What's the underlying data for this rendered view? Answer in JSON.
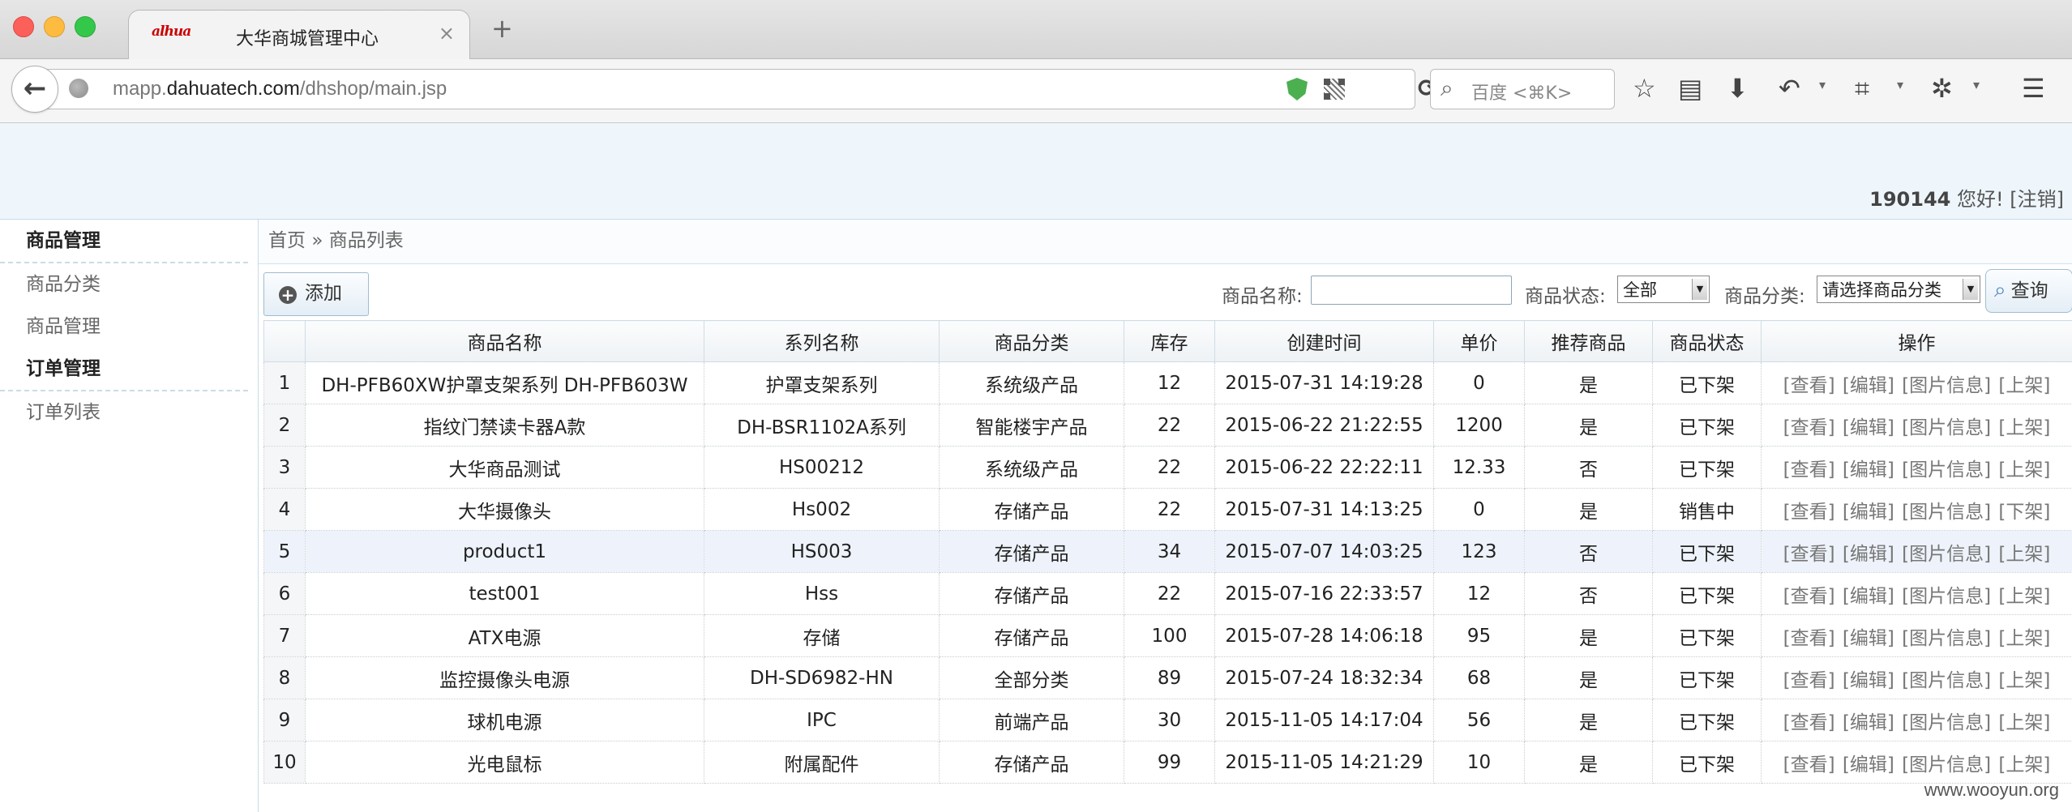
{
  "browser": {
    "tab_title": "大华商城管理中心",
    "tab_close": "×",
    "new_tab": "+",
    "favicon_text": "alhua",
    "url_domain": "mapp.",
    "url_host": "dahuatech.com",
    "url_path": "/dhshop/main.jsp",
    "search_placeholder": "百度 <⌘K>"
  },
  "header": {
    "user_id": "190144",
    "greeting": "您好!",
    "logout": "[注销]"
  },
  "sidebar": {
    "groups": [
      {
        "title": "商品管理",
        "items": [
          "商品分类",
          "商品管理"
        ]
      },
      {
        "title": "订单管理",
        "items": [
          "订单列表"
        ]
      }
    ]
  },
  "breadcrumb": {
    "home": "首页",
    "separator": "»",
    "current": "商品列表"
  },
  "toolbar": {
    "add_label": "添加",
    "name_label": "商品名称:",
    "name_value": "",
    "status_label": "商品状态:",
    "status_value": "全部",
    "category_label": "商品分类:",
    "category_value": "请选择商品分类",
    "query_label": "查询"
  },
  "table": {
    "columns": [
      "",
      "商品名称",
      "系列名称",
      "商品分类",
      "库存",
      "创建时间",
      "单价",
      "推荐商品",
      "商品状态",
      "操作"
    ],
    "rows": [
      {
        "no": "1",
        "name": "DH-PFB60XW护罩支架系列 DH-PFB603W",
        "series": "护罩支架系列",
        "category": "系统级产品",
        "stock": "12",
        "created": "2015-07-31 14:19:28",
        "price": "0",
        "recommended": "是",
        "status": "已下架",
        "ops": [
          "[查看]",
          "[编辑]",
          "[图片信息]",
          "[上架]"
        ]
      },
      {
        "no": "2",
        "name": "指纹门禁读卡器A款",
        "series": "DH-BSR1102A系列",
        "category": "智能楼宇产品",
        "stock": "22",
        "created": "2015-06-22 21:22:55",
        "price": "1200",
        "recommended": "是",
        "status": "已下架",
        "ops": [
          "[查看]",
          "[编辑]",
          "[图片信息]",
          "[上架]"
        ]
      },
      {
        "no": "3",
        "name": "大华商品测试",
        "series": "HS00212",
        "category": "系统级产品",
        "stock": "22",
        "created": "2015-06-22 22:22:11",
        "price": "12.33",
        "recommended": "否",
        "status": "已下架",
        "ops": [
          "[查看]",
          "[编辑]",
          "[图片信息]",
          "[上架]"
        ]
      },
      {
        "no": "4",
        "name": "大华摄像头",
        "series": "Hs002",
        "category": "存储产品",
        "stock": "22",
        "created": "2015-07-31 14:13:25",
        "price": "0",
        "recommended": "是",
        "status": "销售中",
        "ops": [
          "[查看]",
          "[编辑]",
          "[图片信息]",
          "[下架]"
        ]
      },
      {
        "no": "5",
        "name": "product1",
        "series": "HS003",
        "category": "存储产品",
        "stock": "34",
        "created": "2015-07-07 14:03:25",
        "price": "123",
        "recommended": "否",
        "status": "已下架",
        "ops": [
          "[查看]",
          "[编辑]",
          "[图片信息]",
          "[上架]"
        ]
      },
      {
        "no": "6",
        "name": "test001",
        "series": "Hss",
        "category": "存储产品",
        "stock": "22",
        "created": "2015-07-16 22:33:57",
        "price": "12",
        "recommended": "否",
        "status": "已下架",
        "ops": [
          "[查看]",
          "[编辑]",
          "[图片信息]",
          "[上架]"
        ]
      },
      {
        "no": "7",
        "name": "ATX电源",
        "series": "存储",
        "category": "存储产品",
        "stock": "100",
        "created": "2015-07-28 14:06:18",
        "price": "95",
        "recommended": "是",
        "status": "已下架",
        "ops": [
          "[查看]",
          "[编辑]",
          "[图片信息]",
          "[上架]"
        ]
      },
      {
        "no": "8",
        "name": "监控摄像头电源",
        "series": "DH-SD6982-HN",
        "category": "全部分类",
        "stock": "89",
        "created": "2015-07-24 18:32:34",
        "price": "68",
        "recommended": "是",
        "status": "已下架",
        "ops": [
          "[查看]",
          "[编辑]",
          "[图片信息]",
          "[上架]"
        ]
      },
      {
        "no": "9",
        "name": "球机电源",
        "series": "IPC",
        "category": "前端产品",
        "stock": "30",
        "created": "2015-11-05 14:17:04",
        "price": "56",
        "recommended": "是",
        "status": "已下架",
        "ops": [
          "[查看]",
          "[编辑]",
          "[图片信息]",
          "[上架]"
        ]
      },
      {
        "no": "10",
        "name": "光电鼠标",
        "series": "附属配件",
        "category": "存储产品",
        "stock": "99",
        "created": "2015-11-05 14:21:29",
        "price": "10",
        "recommended": "是",
        "status": "已下架",
        "ops": [
          "[查看]",
          "[编辑]",
          "[图片信息]",
          "[上架]"
        ]
      }
    ],
    "highlighted_row": 5
  },
  "watermark": "www.wooyun.org",
  "colors": {
    "header_bg": "#eef6fc",
    "border": "#c8dbe7",
    "highlight_row": "#eef3fb"
  }
}
